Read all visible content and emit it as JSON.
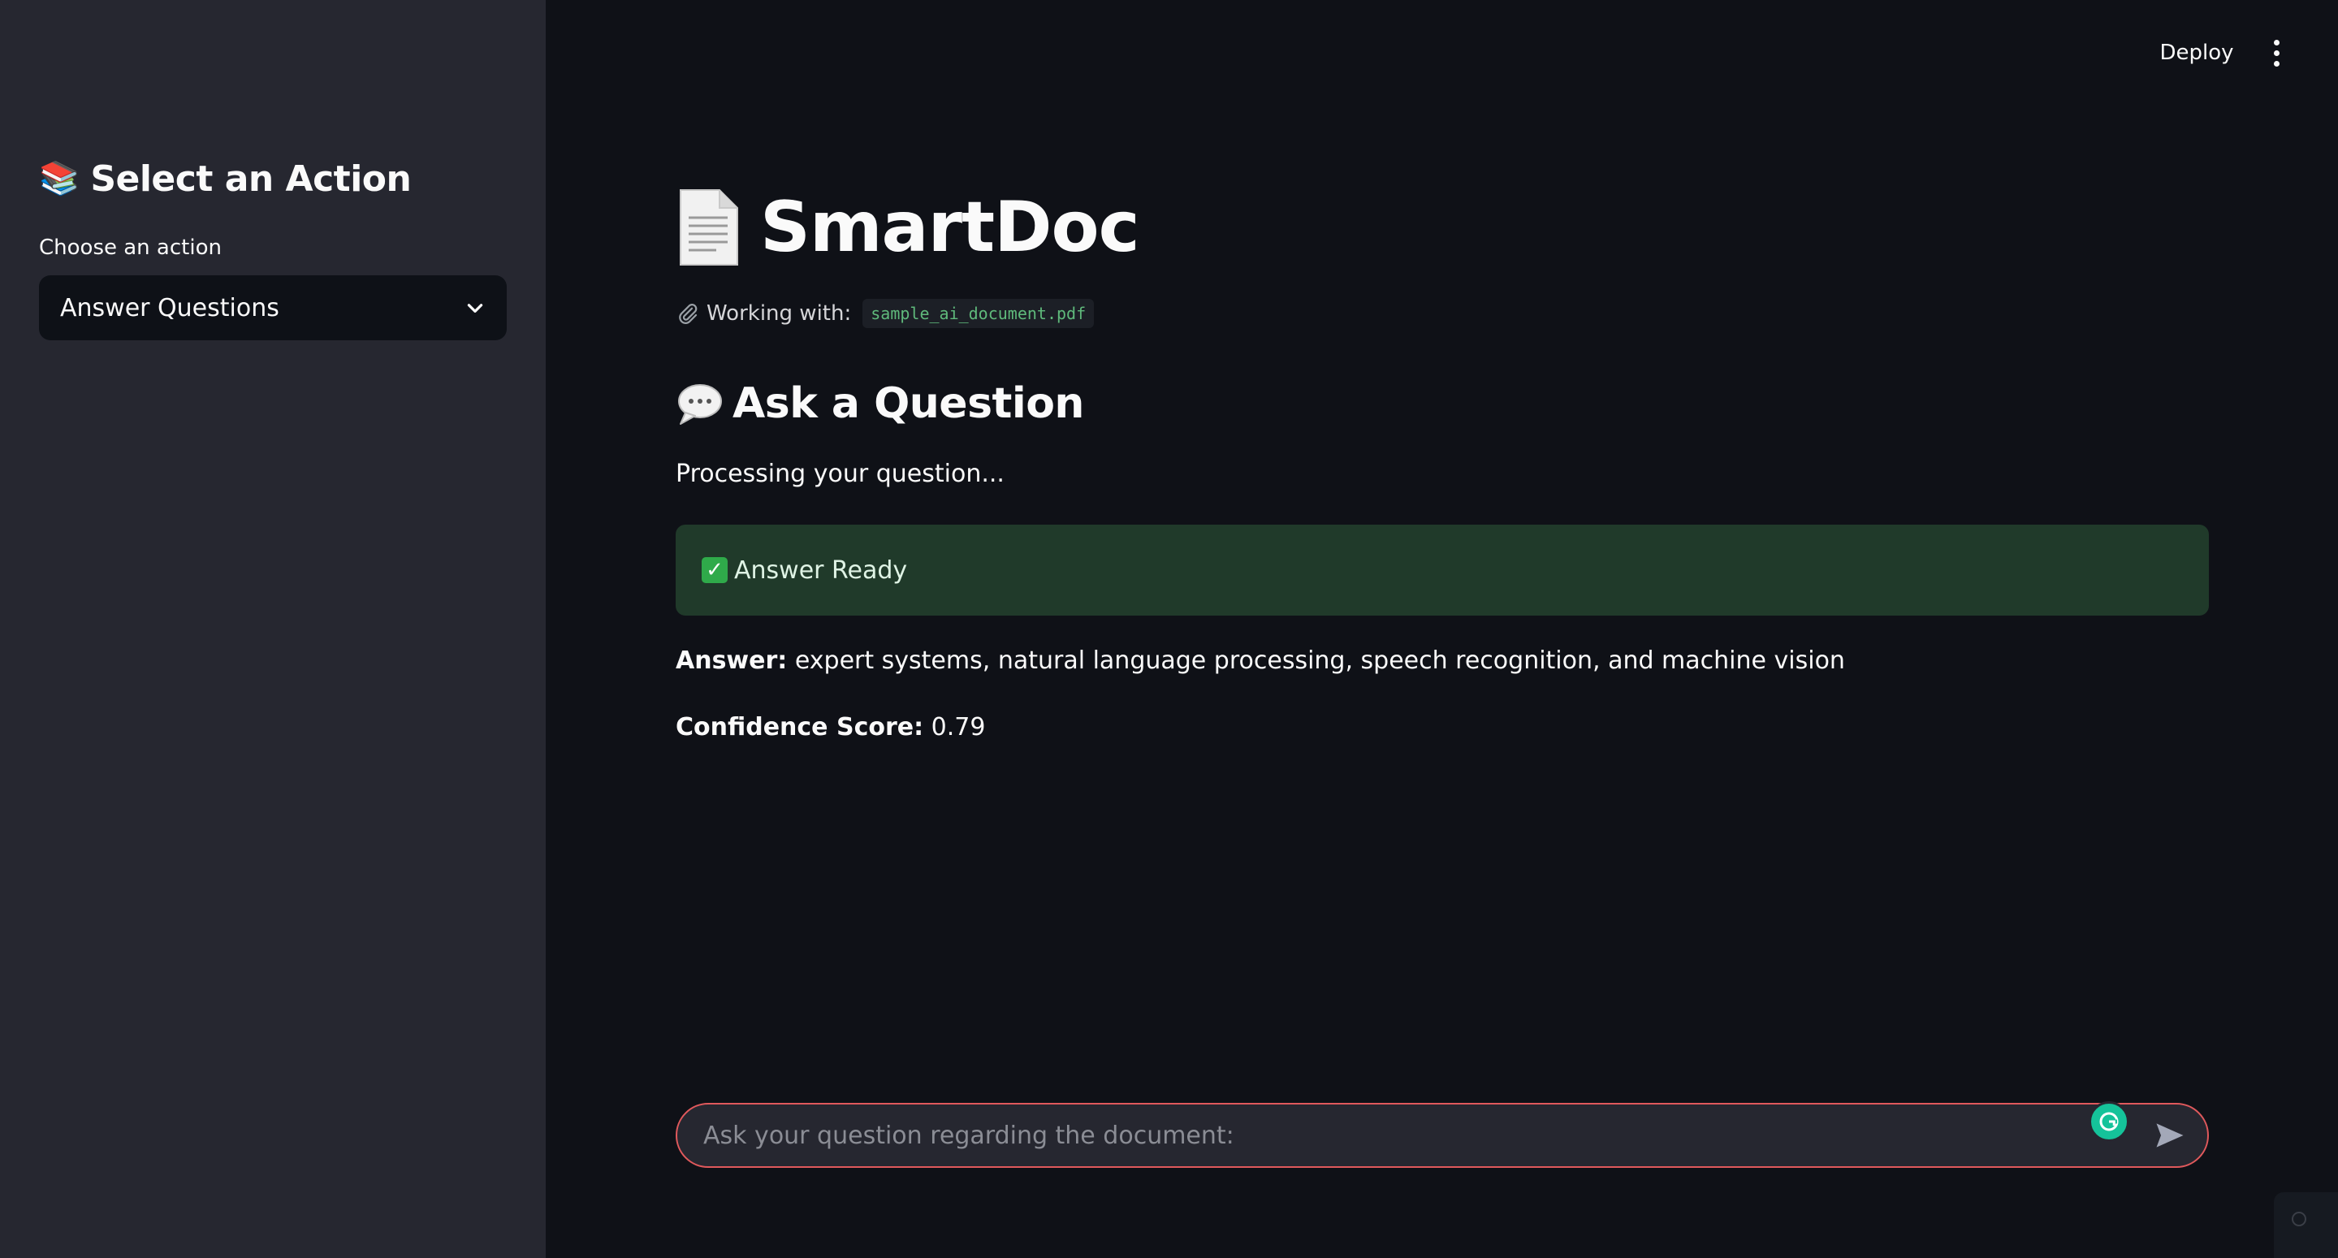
{
  "sidebar": {
    "title_icon": "books-emoji",
    "title": "Select an Action",
    "select_label": "Choose an action",
    "select_value": "Answer Questions"
  },
  "header": {
    "deploy_label": "Deploy",
    "menu_icon": "vertical-ellipsis-icon"
  },
  "main": {
    "title_icon": "page-document-icon",
    "title": "SmartDoc",
    "working_label": "Working with:",
    "working_file": "sample_ai_document.pdf",
    "section_icon": "speech-bubble-icon",
    "section_title": "Ask a Question",
    "processing_text": "Processing your question...",
    "status_label": "Answer Ready",
    "answer_label": "Answer:",
    "answer_text": "expert systems, natural language processing, speech recognition, and machine vision",
    "confidence_label": "Confidence Score:",
    "confidence_value": "0.79"
  },
  "chat": {
    "placeholder": "Ask your question regarding the document:",
    "send_icon": "send-arrow-icon",
    "extension_icon": "grammarly-icon"
  },
  "colors": {
    "sidebar_bg": "#262730",
    "main_bg": "#0f1117",
    "success_bg": "#203a2a",
    "input_border": "#e0595c",
    "code_text": "#5fb97b"
  }
}
